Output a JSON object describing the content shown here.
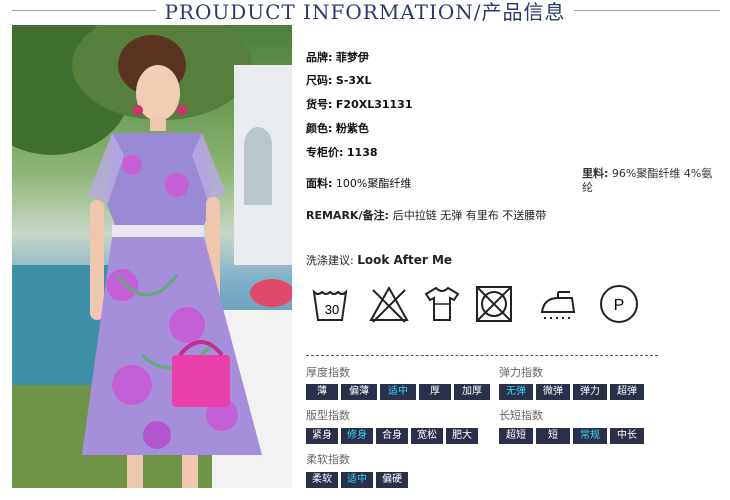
{
  "header": {
    "title": "PROUDUCT INFORMATION/产品信息"
  },
  "photo": {
    "alt": "model wearing purple floral dress"
  },
  "specs": [
    {
      "label": "品牌:",
      "value": "菲梦伊"
    },
    {
      "label": "尺码:",
      "value": "S-3XL"
    },
    {
      "label": "货号:",
      "value": "F20XL31131"
    },
    {
      "label": "颜色:",
      "value": "粉紫色"
    },
    {
      "label": "专柜价:",
      "value": "1138"
    }
  ],
  "fabric": {
    "label": "面料:",
    "value": "100%聚酯纤维"
  },
  "lining": {
    "label": "里料:",
    "value": "96%聚酯纤维 4%氨纶"
  },
  "remark": {
    "label": "REMARK/备注:",
    "value": "后中拉链 无弹 有里布 不送腰带"
  },
  "wash": {
    "label": "洗涤建议:",
    "value": "Look After Me"
  },
  "care": {
    "temp": "30",
    "dry": "P"
  },
  "thickness": {
    "title": "厚度指数",
    "options": [
      "薄",
      "偏薄",
      "适中",
      "厚",
      "加厚"
    ],
    "selected": "适中"
  },
  "elasticity": {
    "title": "弹力指数",
    "options": [
      "无弹",
      "微弹",
      "弹力",
      "超弹"
    ],
    "selected": "无弹"
  },
  "fit": {
    "title": "版型指数",
    "options": [
      "紧身",
      "修身",
      "合身",
      "宽松",
      "肥大"
    ],
    "selected": "修身"
  },
  "length": {
    "title": "长短指数",
    "options": [
      "超短",
      "短",
      "常规",
      "中长"
    ],
    "selected": "常规"
  },
  "softness": {
    "title": "柔软指数",
    "options": [
      "柔软",
      "适中",
      "偏硬"
    ],
    "selected": "适中"
  },
  "colors": {
    "chip_bg": "#2a2f4c",
    "chip_active": "#36d8f5",
    "title": "#2a3a6a"
  }
}
